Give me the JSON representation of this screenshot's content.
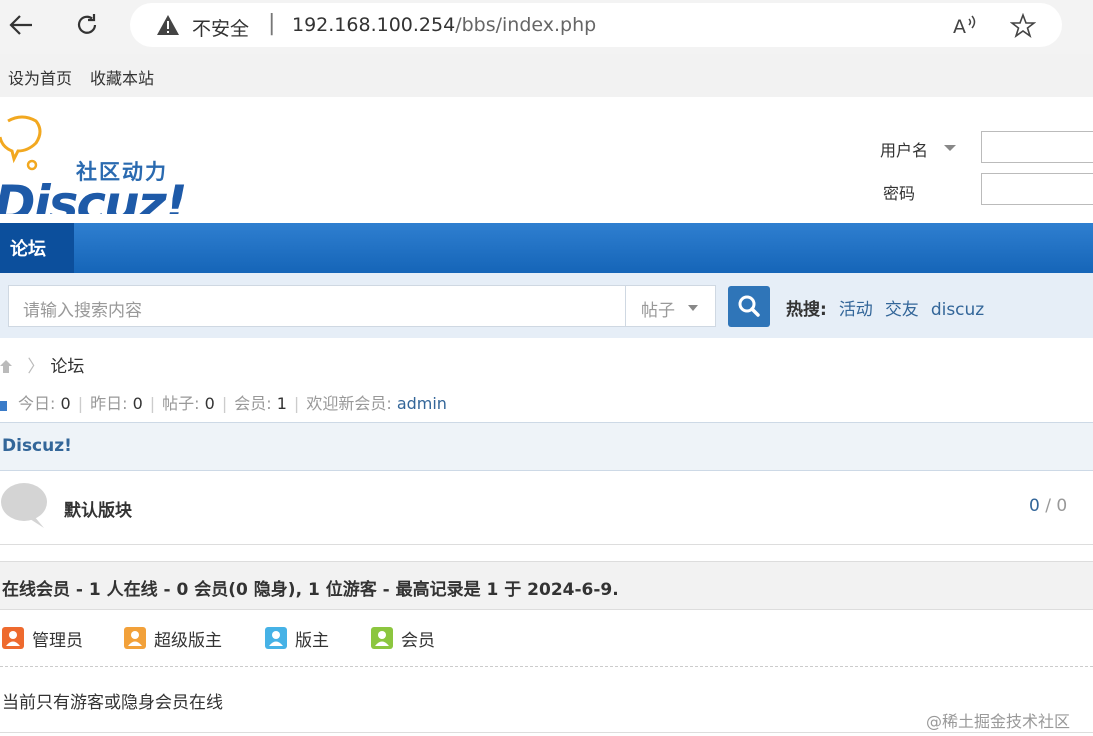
{
  "browser": {
    "insecure_label": "不安全",
    "url_host": "192.168.100.254",
    "url_path": "/bbs/index.php"
  },
  "toplinks": {
    "set_home": "设为首页",
    "bookmark": "收藏本站"
  },
  "header": {
    "logo_text": "社区动力",
    "logo_brand": "Discuz!",
    "username_label": "用户名",
    "password_label": "密码"
  },
  "nav": {
    "forum_tab": "论坛"
  },
  "search": {
    "placeholder": "请输入搜索内容",
    "type": "帖子",
    "hot_label": "热搜:",
    "hot_items": [
      "活动",
      "交友",
      "discuz"
    ]
  },
  "breadcrumb": {
    "current": "论坛"
  },
  "stats": {
    "today_label": "今日:",
    "today": "0",
    "yesterday_label": "昨日:",
    "yesterday": "0",
    "posts_label": "帖子:",
    "posts": "0",
    "members_label": "会员:",
    "members": "1",
    "welcome_label": "欢迎新会员:",
    "newest": "admin"
  },
  "forum_group": {
    "title": "Discuz!",
    "forums": [
      {
        "name": "默认版块",
        "counts": "0",
        "counts_b": "0"
      }
    ]
  },
  "online": {
    "header": "在线会员 - 1 人在线 - 0 会员(0 隐身), 1 位游客 - 最高记录是 1 于 2024-6-9.",
    "legend": [
      "管理员",
      "超级版主",
      "版主",
      "会员"
    ],
    "note": "当前只有游客或隐身会员在线"
  },
  "watermark": "@稀土掘金技术社区",
  "colors": {
    "nav_blue": "#1565b8",
    "link": "#336699",
    "admin": "#ee6a2e",
    "super_mod": "#f2a13a",
    "mod": "#46b2e6",
    "member": "#8cc63f"
  }
}
